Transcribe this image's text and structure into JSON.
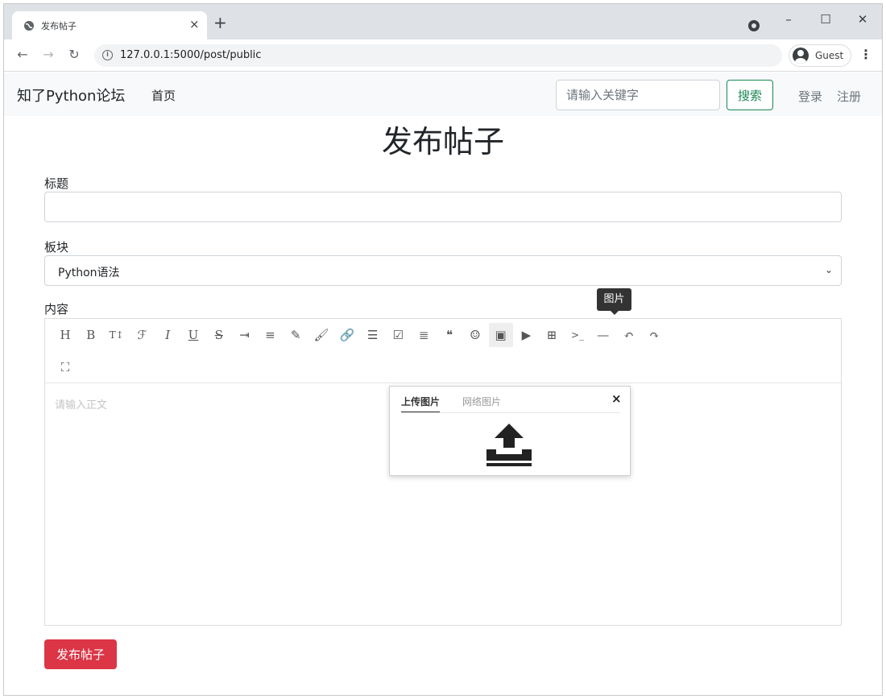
{
  "browser": {
    "tab_title": "发布帖子",
    "url": "127.0.0.1:5000/post/public",
    "profile_label": "Guest",
    "new_tab": "+",
    "tab_close": "×"
  },
  "navbar": {
    "brand": "知了Python论坛",
    "home": "首页",
    "search_placeholder": "请输入关键字",
    "search_button": "搜索",
    "login": "登录",
    "register": "注册"
  },
  "page": {
    "title": "发布帖子",
    "title_label": "标题",
    "board_label": "板块",
    "board_value": "Python语法",
    "content_label": "内容",
    "editor_placeholder": "请输入正文",
    "publish_button": "发布帖子"
  },
  "editor": {
    "tooltip": "图片",
    "tools": [
      {
        "name": "heading-icon",
        "glyph": "H"
      },
      {
        "name": "bold-icon",
        "glyph": "B"
      },
      {
        "name": "font-size-icon",
        "glyph": "T↕"
      },
      {
        "name": "font-family-icon",
        "glyph": "ℱ"
      },
      {
        "name": "italic-icon",
        "glyph": "I"
      },
      {
        "name": "underline-icon",
        "glyph": "U"
      },
      {
        "name": "strikethrough-icon",
        "glyph": "S"
      },
      {
        "name": "indent-icon",
        "glyph": "⇥"
      },
      {
        "name": "line-height-icon",
        "glyph": "≡"
      },
      {
        "name": "font-color-icon",
        "glyph": "✎"
      },
      {
        "name": "background-color-icon",
        "glyph": "🖌"
      },
      {
        "name": "link-icon",
        "glyph": "🔗"
      },
      {
        "name": "list-icon",
        "glyph": "☰"
      },
      {
        "name": "todo-icon",
        "glyph": "☑"
      },
      {
        "name": "justify-icon",
        "glyph": "≣"
      },
      {
        "name": "quote-icon",
        "glyph": "❝"
      },
      {
        "name": "emoticon-icon",
        "glyph": "☺"
      },
      {
        "name": "image-icon",
        "glyph": "▣"
      },
      {
        "name": "video-icon",
        "glyph": "▶"
      },
      {
        "name": "table-icon",
        "glyph": "⊞"
      },
      {
        "name": "code-icon",
        "glyph": ">_"
      },
      {
        "name": "divider-icon",
        "glyph": "—"
      },
      {
        "name": "undo-icon",
        "glyph": "↶"
      },
      {
        "name": "redo-icon",
        "glyph": "↷"
      },
      {
        "name": "fullscreen-icon",
        "glyph": "⛶"
      }
    ],
    "image_panel": {
      "upload_tab": "上传图片",
      "web_tab": "网络图片",
      "close": "×"
    }
  },
  "colors": {
    "search_button": "#198754",
    "publish_button": "#dc3545",
    "navbar_bg": "#f8f9fa"
  }
}
